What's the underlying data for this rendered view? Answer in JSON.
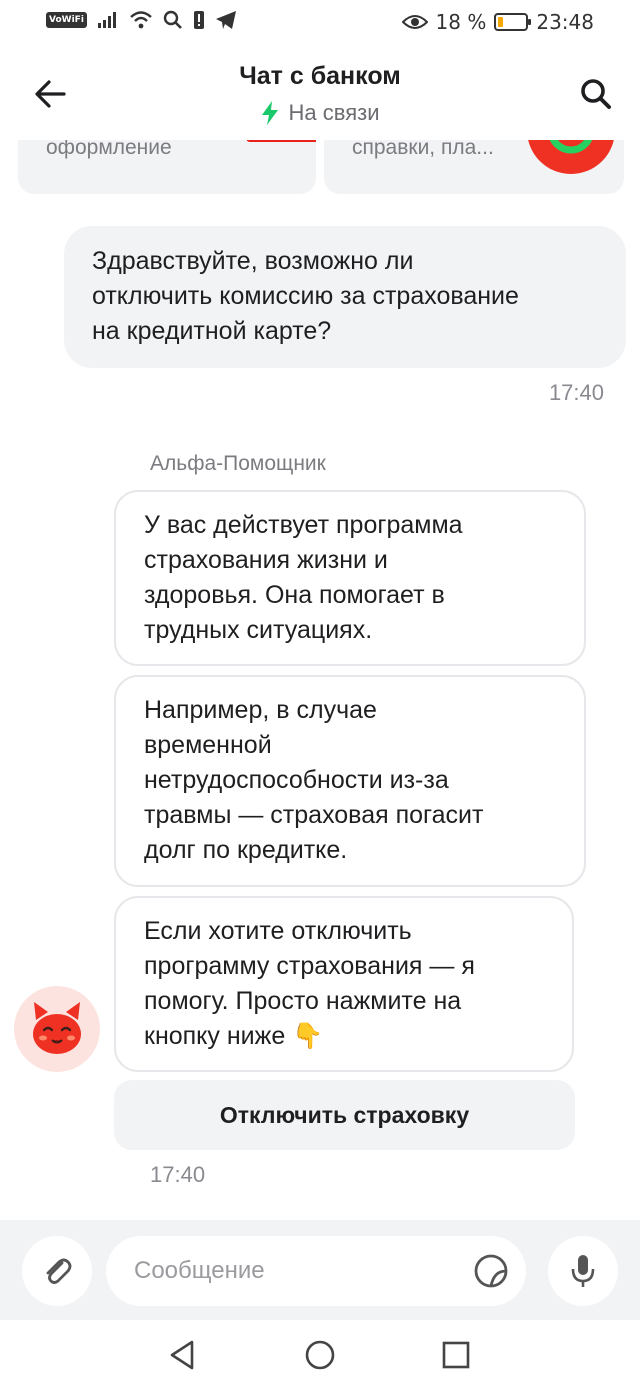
{
  "statusbar": {
    "vowifi": "VoWiFi",
    "battery": "18 %",
    "battery_level": 0.18,
    "time": "23:48",
    "icons": [
      "signal-icon",
      "wifi-icon",
      "search-icon",
      "notification-icon",
      "telegram-icon",
      "eye-icon",
      "battery-icon"
    ]
  },
  "header": {
    "title": "Чат с банком",
    "status": "На связи",
    "icons": {
      "back": "arrow-left-icon",
      "search": "search-icon",
      "status": "lightning-icon"
    }
  },
  "promos": [
    {
      "text": "оформление",
      "icon": "percent-icon"
    },
    {
      "text": "справки, пла...",
      "icon": "refresh-icon"
    }
  ],
  "messages": {
    "outgoing": {
      "lines": [
        "Здравствуйте, возможно ли",
        "отключить комиссию за страхование",
        "на кредитной карте?"
      ],
      "time": "17:40"
    },
    "incoming": {
      "sender": "Альфа-Помощник",
      "bubbles": [
        [
          "У вас действует программа",
          "страхования жизни и",
          "здоровья. Она помогает в",
          "трудных ситуациях."
        ],
        [
          "Например, в случае",
          "временной",
          "нетрудоспособности из-за",
          "травмы — страховая погасит",
          "долг по кредитке."
        ],
        [
          "Если хотите отключить",
          "программу страхования — я",
          "помогу. Просто нажмите на",
          "кнопку ниже 👇"
        ]
      ],
      "action_button": "Отключить страховку",
      "time": "17:40"
    }
  },
  "input": {
    "placeholder": "Сообщение",
    "icons": {
      "attach": "paperclip-icon",
      "sticker": "sticker-icon",
      "mic": "microphone-icon"
    }
  },
  "navbar": {
    "icons": [
      "back-triangle-icon",
      "home-circle-icon",
      "recents-square-icon"
    ]
  },
  "colors": {
    "accent_green": "#1bc96b",
    "brand_red": "#ef3124",
    "bubble_grey": "#f2f3f5"
  }
}
